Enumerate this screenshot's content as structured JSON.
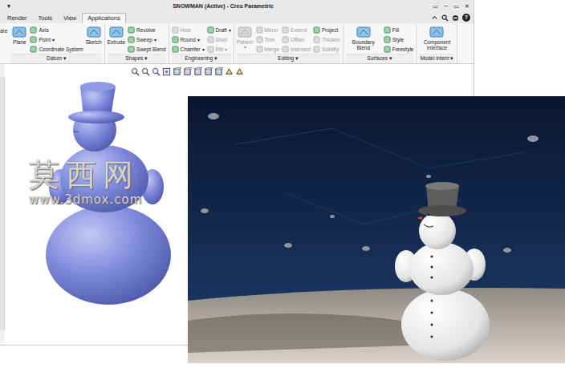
{
  "window": {
    "title": "SNOWMAN (Active) - Creo Parametric",
    "menu": "▾",
    "controls": [
      "▭",
      "─",
      "▭",
      "✕"
    ]
  },
  "tabs": [
    {
      "label": "Render",
      "selected": false
    },
    {
      "label": "Tools",
      "selected": false
    },
    {
      "label": "View",
      "selected": false
    },
    {
      "label": "Applications",
      "selected": true
    }
  ],
  "help": {
    "label": "?"
  },
  "ribbon": {
    "cut_item": "are",
    "groups": [
      {
        "label": "Datum",
        "dropdown": "▾",
        "columns": [
          {
            "kind": "large",
            "items": [
              {
                "label": "Plane",
                "disabled": false
              }
            ]
          },
          {
            "kind": "small",
            "items": [
              {
                "label": "Axis",
                "disabled": false
              },
              {
                "label": "Point",
                "dropdown": "▾",
                "disabled": false
              },
              {
                "label": "Coordinate System",
                "disabled": false
              }
            ]
          },
          {
            "kind": "large",
            "items": [
              {
                "label": "Sketch",
                "disabled": false
              }
            ]
          }
        ]
      },
      {
        "label": "Shapes",
        "dropdown": "▾",
        "columns": [
          {
            "kind": "large",
            "items": [
              {
                "label": "Extrude",
                "disabled": false
              }
            ]
          },
          {
            "kind": "small",
            "items": [
              {
                "label": "Revolve",
                "disabled": false
              },
              {
                "label": "Sweep",
                "dropdown": "▾",
                "disabled": false
              },
              {
                "label": "Swept Blend",
                "disabled": false
              }
            ]
          }
        ]
      },
      {
        "label": "Engineering",
        "dropdown": "▾",
        "columns": [
          {
            "kind": "small",
            "items": [
              {
                "label": "Hole",
                "disabled": true
              },
              {
                "label": "Round",
                "dropdown": "▾",
                "disabled": false
              },
              {
                "label": "Chamfer",
                "dropdown": "▾",
                "disabled": false
              }
            ]
          },
          {
            "kind": "small",
            "items": [
              {
                "label": "Draft",
                "dropdown": "▾",
                "disabled": false
              },
              {
                "label": "Shell",
                "disabled": true
              },
              {
                "label": "Rib",
                "dropdown": "▾",
                "disabled": true
              }
            ]
          }
        ]
      },
      {
        "label": "Editing",
        "dropdown": "▾",
        "columns": [
          {
            "kind": "large",
            "items": [
              {
                "label": "Pattern",
                "dropdown": "▾",
                "disabled": true
              }
            ]
          },
          {
            "kind": "small",
            "items": [
              {
                "label": "Mirror",
                "disabled": true
              },
              {
                "label": "Trim",
                "disabled": true
              },
              {
                "label": "Merge",
                "disabled": true
              }
            ]
          },
          {
            "kind": "small",
            "items": [
              {
                "label": "Extend",
                "disabled": true
              },
              {
                "label": "Offset",
                "disabled": true
              },
              {
                "label": "Intersect",
                "disabled": true
              }
            ]
          },
          {
            "kind": "small",
            "items": [
              {
                "label": "Project",
                "disabled": false
              },
              {
                "label": "Thicken",
                "disabled": true
              },
              {
                "label": "Solidify",
                "disabled": true
              }
            ]
          }
        ]
      },
      {
        "label": "Surfaces",
        "dropdown": "▾",
        "columns": [
          {
            "kind": "large",
            "items": [
              {
                "label": "Boundary Blend",
                "disabled": false
              }
            ]
          },
          {
            "kind": "small",
            "items": [
              {
                "label": "Fill",
                "disabled": false
              },
              {
                "label": "Style",
                "disabled": false
              },
              {
                "label": "Freestyle",
                "disabled": false
              }
            ]
          }
        ]
      },
      {
        "label": "Model Intent",
        "dropdown": "▾",
        "columns": [
          {
            "kind": "large",
            "items": [
              {
                "label": "Component Interface",
                "disabled": false
              }
            ]
          }
        ]
      }
    ]
  },
  "watermark": {
    "title": "莫西网",
    "url": "www.3dmox.com"
  }
}
